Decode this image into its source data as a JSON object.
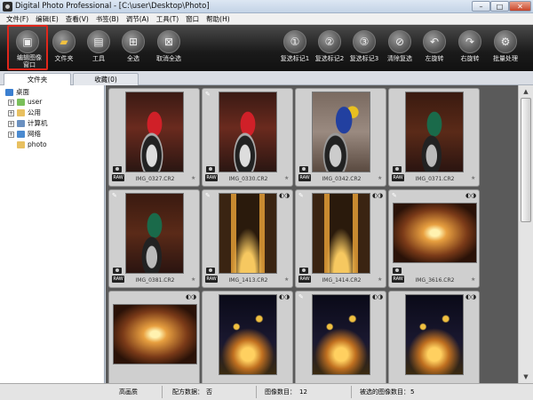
{
  "window": {
    "title": "Digital Photo Professional - [C:\\user\\Desktop\\Photo]",
    "min": "–",
    "max": "□",
    "close": "✕"
  },
  "menu": [
    "文件(F)",
    "编辑(E)",
    "查看(V)",
    "书签(B)",
    "调节(A)",
    "工具(T)",
    "窗口",
    "帮助(H)"
  ],
  "toolbar": {
    "edit_line1": "编辑图像",
    "edit_line2": "窗口",
    "folder": "文件夹",
    "tools": "工具",
    "select_all": "全选",
    "deselect_all": "取消全选",
    "mark1": "复选标记1",
    "mark2": "复选标记2",
    "mark3": "复选标记3",
    "clear_mark": "清除复选",
    "rotate_left": "左旋转",
    "rotate_right": "右旋转",
    "batch": "批量处理"
  },
  "tabs": {
    "folder": "文件夹",
    "favorites": "收藏(0)"
  },
  "tree": {
    "desktop": "桌面",
    "user": "user",
    "public": "公用",
    "computer": "计算机",
    "network": "网络",
    "photo": "photo"
  },
  "thumbnails": [
    {
      "name": "IMG_0327.CR2",
      "image": "bike-red"
    },
    {
      "name": "IMG_0330.CR2",
      "image": "bike-red"
    },
    {
      "name": "IMG_0342.CR2",
      "image": "bike-blue"
    },
    {
      "name": "IMG_0371.CR2",
      "image": "bike-green"
    },
    {
      "name": "IMG_0381.CR2",
      "image": "bike-green"
    },
    {
      "name": "IMG_1413.CR2",
      "image": "street-night"
    },
    {
      "name": "IMG_1414.CR2",
      "image": "street-night"
    },
    {
      "name": "IMG_3616.CR2",
      "image": "arcade"
    },
    {
      "name": "",
      "image": "arcade"
    },
    {
      "name": "",
      "image": "city-night"
    },
    {
      "name": "",
      "image": "city-night"
    },
    {
      "name": "",
      "image": "city-night"
    }
  ],
  "badge": {
    "raw": "RAW"
  },
  "status": {
    "quality": "高画质",
    "recipe_label": "配方数据：",
    "recipe_value": "否",
    "count_label": "图像数目：",
    "count_value": "12",
    "selected_label": "被选的图像数目：",
    "selected_value": "5"
  },
  "scroll": {
    "up": "▲",
    "down": "▼"
  },
  "colors": {
    "highlight_border": "#e0261b",
    "toolbar_bg": "#1a1a1a",
    "grid_bg": "#5a5a5a"
  }
}
